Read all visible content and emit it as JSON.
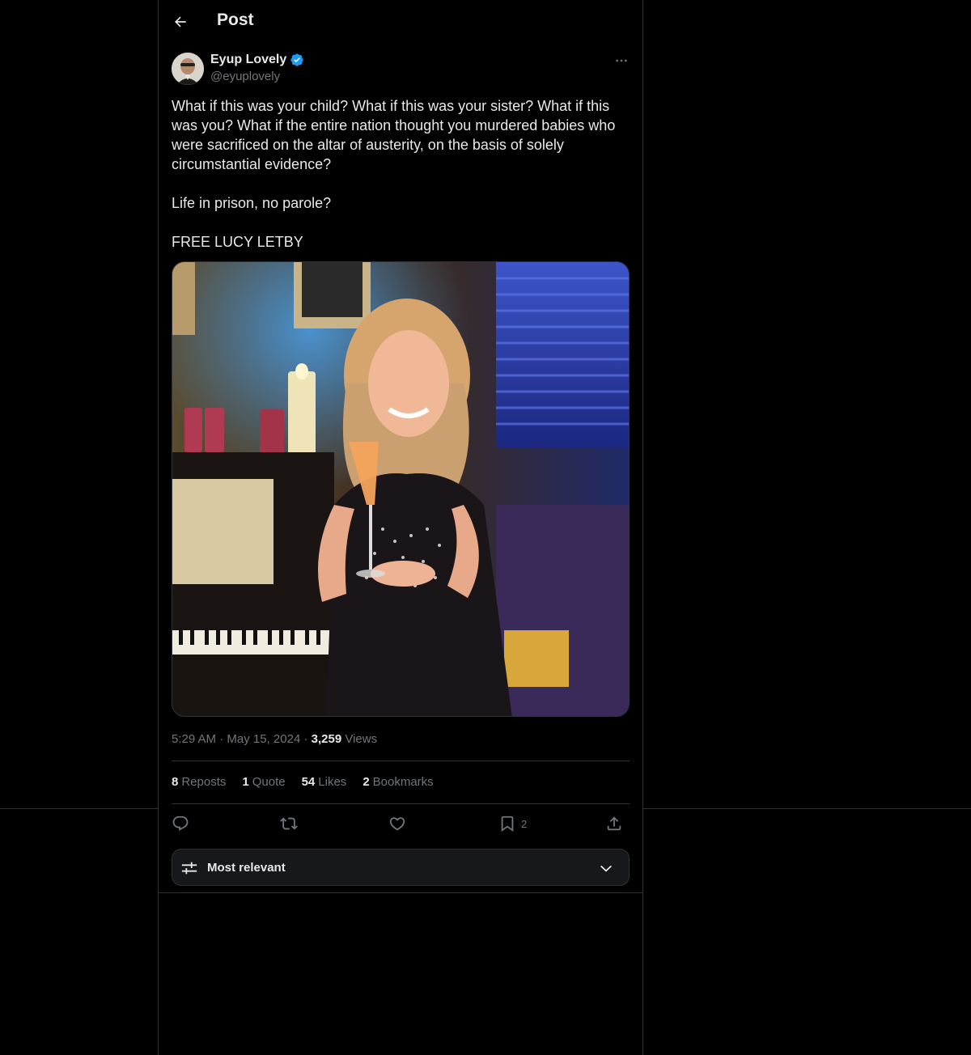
{
  "header": {
    "title": "Post"
  },
  "post": {
    "author_name": "Eyup Lovely",
    "author_handle": "@eyuplovely",
    "text_p1": "What if this was your child? What if this was your sister? What if this was you? What if the entire nation thought you murdered babies who were sacrificed on the altar of austerity, on the basis of solely circumstantial evidence?",
    "text_p2": "Life in prison, no parole?",
    "text_p3": "FREE LUCY LETBY",
    "time": "5:29 AM",
    "dot": "·",
    "date": "May 15, 2024",
    "views_count": "3,259",
    "views_label": "Views"
  },
  "stats": {
    "reposts_count": "8",
    "reposts_label": "Reposts",
    "quotes_count": "1",
    "quotes_label": "Quote",
    "likes_count": "54",
    "likes_label": "Likes",
    "bookmarks_count": "2",
    "bookmarks_label": "Bookmarks"
  },
  "actions": {
    "bookmark_count": "2"
  },
  "sort": {
    "label": "Most relevant"
  },
  "colors": {
    "verified": "#1d9bf0",
    "muted": "#71767b",
    "text": "#e7e9ea",
    "border": "#2f3336"
  },
  "icons": [
    "back-arrow-icon",
    "verified-badge-icon",
    "more-icon",
    "reply-icon",
    "repost-icon",
    "like-icon",
    "bookmark-icon",
    "share-icon",
    "sliders-icon",
    "chevron-down-icon"
  ]
}
